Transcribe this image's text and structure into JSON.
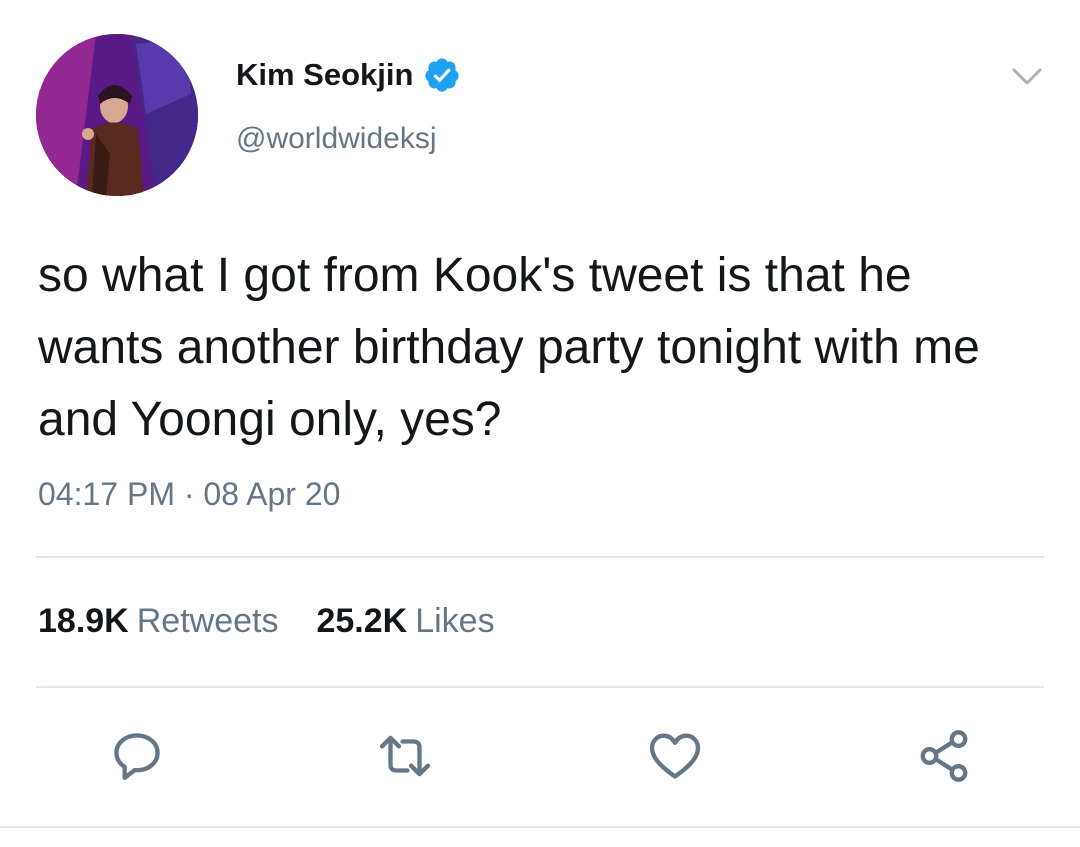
{
  "user": {
    "display_name": "Kim Seokjin",
    "handle": "@worldwideksj",
    "verified": true
  },
  "tweet": {
    "text": "so what I got from Kook's tweet is that he wants another birthday party tonight with me and Yoongi only, yes?",
    "timestamp": "04:17 PM · 08 Apr 20"
  },
  "stats": {
    "retweets_count": "18.9K",
    "retweets_label": "Retweets",
    "likes_count": "25.2K",
    "likes_label": "Likes"
  },
  "actions": {
    "reply_icon": "reply-icon",
    "retweet_icon": "retweet-icon",
    "like_icon": "heart-icon",
    "share_icon": "share-icon"
  },
  "colors": {
    "text_primary": "#14171a",
    "text_secondary": "#657786",
    "verified_blue": "#1da1f2",
    "divider": "#e1e8ed"
  }
}
